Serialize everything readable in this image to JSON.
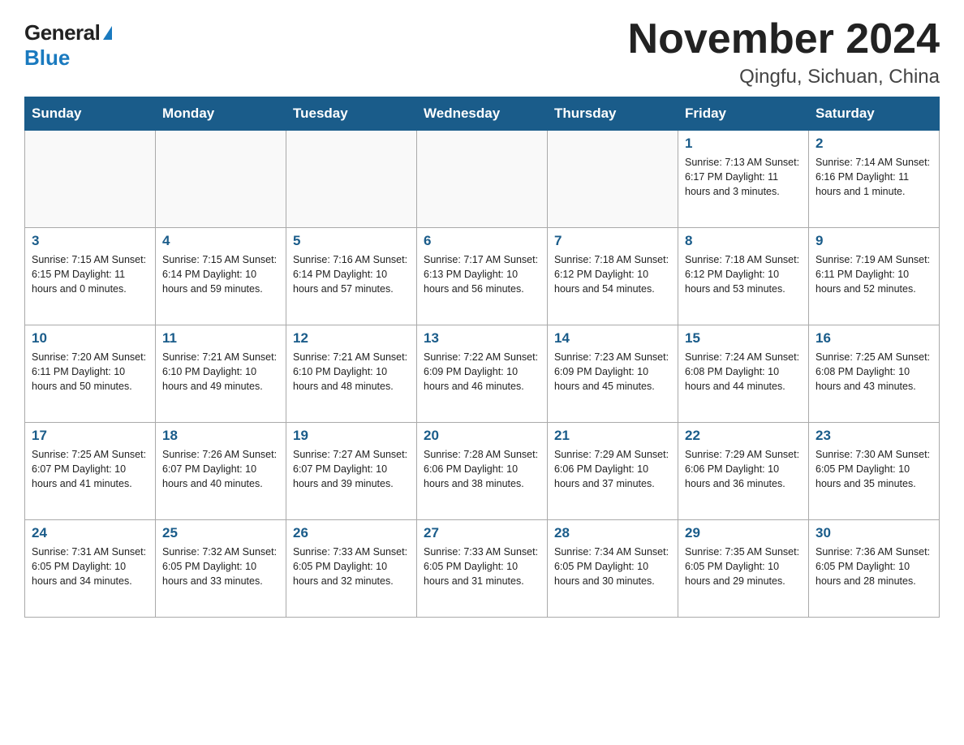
{
  "logo": {
    "general": "General",
    "blue": "Blue"
  },
  "title": "November 2024",
  "subtitle": "Qingfu, Sichuan, China",
  "days_of_week": [
    "Sunday",
    "Monday",
    "Tuesday",
    "Wednesday",
    "Thursday",
    "Friday",
    "Saturday"
  ],
  "weeks": [
    [
      {
        "day": "",
        "info": ""
      },
      {
        "day": "",
        "info": ""
      },
      {
        "day": "",
        "info": ""
      },
      {
        "day": "",
        "info": ""
      },
      {
        "day": "",
        "info": ""
      },
      {
        "day": "1",
        "info": "Sunrise: 7:13 AM\nSunset: 6:17 PM\nDaylight: 11 hours\nand 3 minutes."
      },
      {
        "day": "2",
        "info": "Sunrise: 7:14 AM\nSunset: 6:16 PM\nDaylight: 11 hours\nand 1 minute."
      }
    ],
    [
      {
        "day": "3",
        "info": "Sunrise: 7:15 AM\nSunset: 6:15 PM\nDaylight: 11 hours\nand 0 minutes."
      },
      {
        "day": "4",
        "info": "Sunrise: 7:15 AM\nSunset: 6:14 PM\nDaylight: 10 hours\nand 59 minutes."
      },
      {
        "day": "5",
        "info": "Sunrise: 7:16 AM\nSunset: 6:14 PM\nDaylight: 10 hours\nand 57 minutes."
      },
      {
        "day": "6",
        "info": "Sunrise: 7:17 AM\nSunset: 6:13 PM\nDaylight: 10 hours\nand 56 minutes."
      },
      {
        "day": "7",
        "info": "Sunrise: 7:18 AM\nSunset: 6:12 PM\nDaylight: 10 hours\nand 54 minutes."
      },
      {
        "day": "8",
        "info": "Sunrise: 7:18 AM\nSunset: 6:12 PM\nDaylight: 10 hours\nand 53 minutes."
      },
      {
        "day": "9",
        "info": "Sunrise: 7:19 AM\nSunset: 6:11 PM\nDaylight: 10 hours\nand 52 minutes."
      }
    ],
    [
      {
        "day": "10",
        "info": "Sunrise: 7:20 AM\nSunset: 6:11 PM\nDaylight: 10 hours\nand 50 minutes."
      },
      {
        "day": "11",
        "info": "Sunrise: 7:21 AM\nSunset: 6:10 PM\nDaylight: 10 hours\nand 49 minutes."
      },
      {
        "day": "12",
        "info": "Sunrise: 7:21 AM\nSunset: 6:10 PM\nDaylight: 10 hours\nand 48 minutes."
      },
      {
        "day": "13",
        "info": "Sunrise: 7:22 AM\nSunset: 6:09 PM\nDaylight: 10 hours\nand 46 minutes."
      },
      {
        "day": "14",
        "info": "Sunrise: 7:23 AM\nSunset: 6:09 PM\nDaylight: 10 hours\nand 45 minutes."
      },
      {
        "day": "15",
        "info": "Sunrise: 7:24 AM\nSunset: 6:08 PM\nDaylight: 10 hours\nand 44 minutes."
      },
      {
        "day": "16",
        "info": "Sunrise: 7:25 AM\nSunset: 6:08 PM\nDaylight: 10 hours\nand 43 minutes."
      }
    ],
    [
      {
        "day": "17",
        "info": "Sunrise: 7:25 AM\nSunset: 6:07 PM\nDaylight: 10 hours\nand 41 minutes."
      },
      {
        "day": "18",
        "info": "Sunrise: 7:26 AM\nSunset: 6:07 PM\nDaylight: 10 hours\nand 40 minutes."
      },
      {
        "day": "19",
        "info": "Sunrise: 7:27 AM\nSunset: 6:07 PM\nDaylight: 10 hours\nand 39 minutes."
      },
      {
        "day": "20",
        "info": "Sunrise: 7:28 AM\nSunset: 6:06 PM\nDaylight: 10 hours\nand 38 minutes."
      },
      {
        "day": "21",
        "info": "Sunrise: 7:29 AM\nSunset: 6:06 PM\nDaylight: 10 hours\nand 37 minutes."
      },
      {
        "day": "22",
        "info": "Sunrise: 7:29 AM\nSunset: 6:06 PM\nDaylight: 10 hours\nand 36 minutes."
      },
      {
        "day": "23",
        "info": "Sunrise: 7:30 AM\nSunset: 6:05 PM\nDaylight: 10 hours\nand 35 minutes."
      }
    ],
    [
      {
        "day": "24",
        "info": "Sunrise: 7:31 AM\nSunset: 6:05 PM\nDaylight: 10 hours\nand 34 minutes."
      },
      {
        "day": "25",
        "info": "Sunrise: 7:32 AM\nSunset: 6:05 PM\nDaylight: 10 hours\nand 33 minutes."
      },
      {
        "day": "26",
        "info": "Sunrise: 7:33 AM\nSunset: 6:05 PM\nDaylight: 10 hours\nand 32 minutes."
      },
      {
        "day": "27",
        "info": "Sunrise: 7:33 AM\nSunset: 6:05 PM\nDaylight: 10 hours\nand 31 minutes."
      },
      {
        "day": "28",
        "info": "Sunrise: 7:34 AM\nSunset: 6:05 PM\nDaylight: 10 hours\nand 30 minutes."
      },
      {
        "day": "29",
        "info": "Sunrise: 7:35 AM\nSunset: 6:05 PM\nDaylight: 10 hours\nand 29 minutes."
      },
      {
        "day": "30",
        "info": "Sunrise: 7:36 AM\nSunset: 6:05 PM\nDaylight: 10 hours\nand 28 minutes."
      }
    ]
  ]
}
